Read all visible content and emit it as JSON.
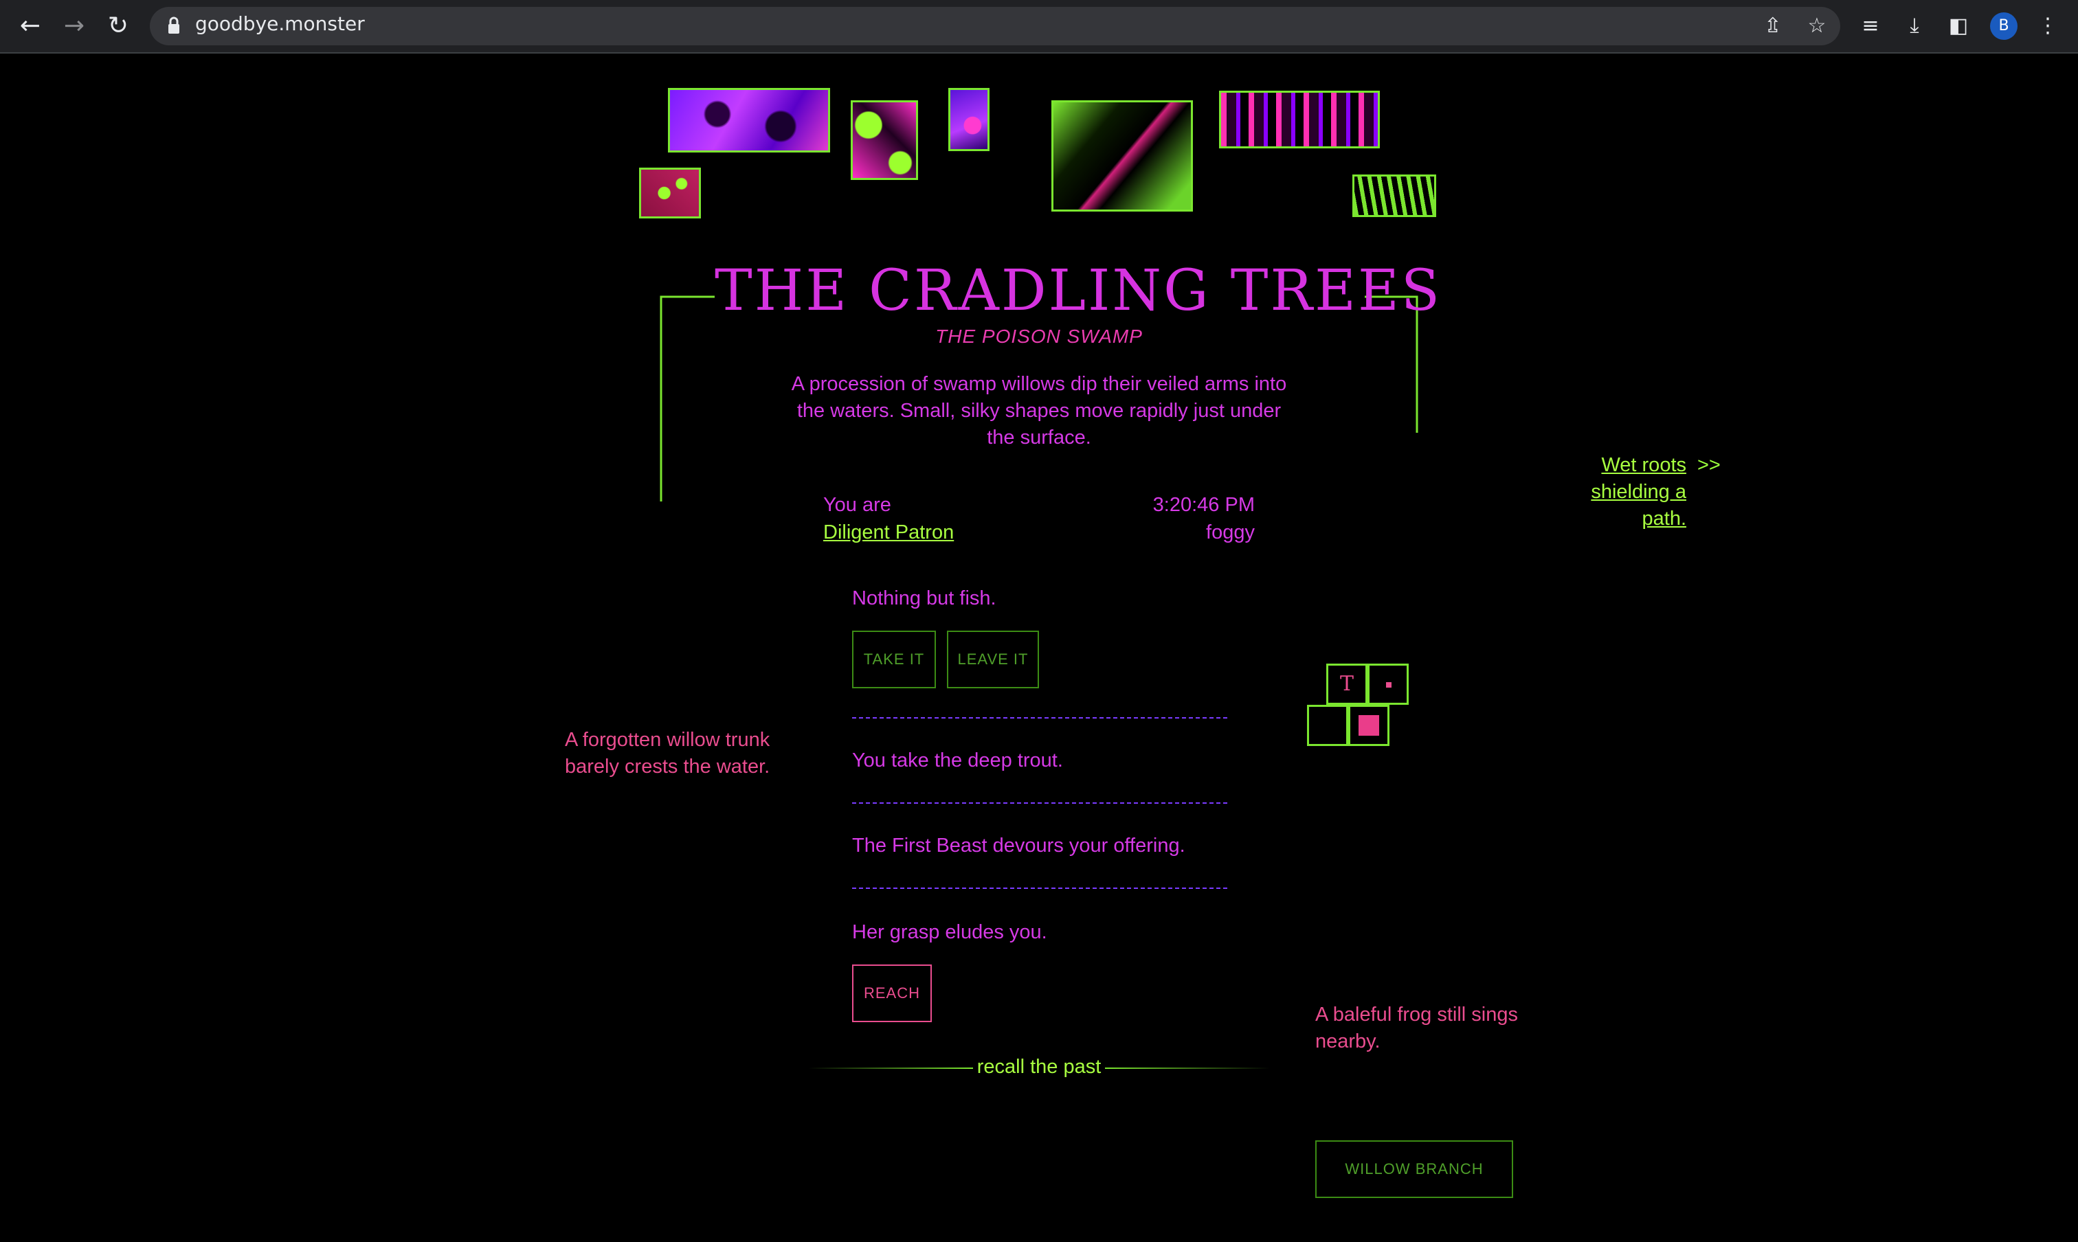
{
  "browser": {
    "url": "goodbye.monster",
    "profile_initial": "B"
  },
  "location": {
    "title": "THE CRADLING TREES",
    "subtitle": "THE POISON SWAMP",
    "description": "A procession of swamp willows dip their veiled arms into the waters. Small, silky shapes move rapidly just under the surface."
  },
  "player": {
    "you_are_label": "You are",
    "name": "Diligent Patron",
    "time": "3:20:46 PM",
    "weather": "foggy"
  },
  "exit": {
    "link_text_line1": "Wet roots",
    "link_text_line2": "shielding a path.",
    "arrow": ">>"
  },
  "events": [
    {
      "text": "Nothing but fish."
    },
    {
      "text": "You take the deep trout."
    },
    {
      "text": "The First Beast devours your offering."
    },
    {
      "text": "Her grasp eludes you."
    }
  ],
  "actions": {
    "take_label": "TAKE IT",
    "leave_label": "LEAVE IT",
    "reach_label": "REACH"
  },
  "recall_label": "recall the past",
  "side_notes": {
    "left": "A forgotten willow trunk barely crests the water.",
    "right": "A baleful frog still sings nearby."
  },
  "item_button": "WILLOW BRANCH",
  "minimap": {
    "marker_letter": "T"
  },
  "colors": {
    "background": "#000000",
    "accent_green": "#9aff3c",
    "accent_pink": "#e63cc3",
    "accent_rose": "#ea4d8f",
    "divider_purple": "#7a3bff"
  }
}
